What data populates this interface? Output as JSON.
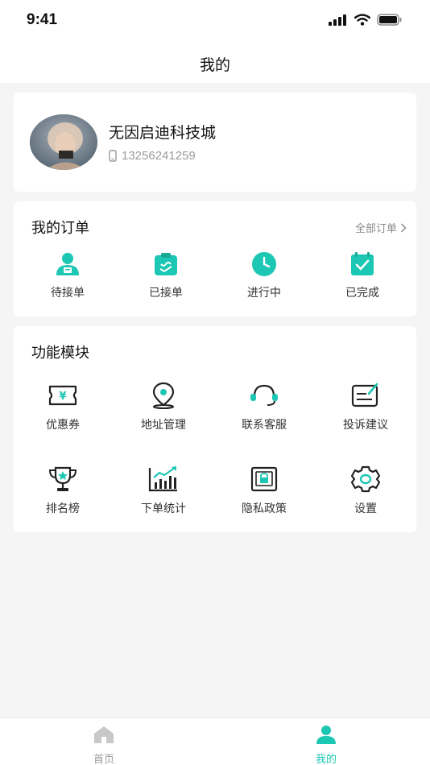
{
  "status_bar": {
    "time": "9:41"
  },
  "header": {
    "title": "我的"
  },
  "profile": {
    "name": "无因启迪科技城",
    "phone": "13256241259"
  },
  "orders": {
    "title": "我的订单",
    "all_label": "全部订单",
    "items": [
      {
        "label": "待接单",
        "icon": "pending-order-icon"
      },
      {
        "label": "已接单",
        "icon": "accepted-order-icon"
      },
      {
        "label": "进行中",
        "icon": "clock-icon"
      },
      {
        "label": "已完成",
        "icon": "completed-check-icon"
      }
    ]
  },
  "modules": {
    "title": "功能模块",
    "items": [
      {
        "label": "优惠券",
        "icon": "coupon-icon"
      },
      {
        "label": "地址管理",
        "icon": "location-pin-icon"
      },
      {
        "label": "联系客服",
        "icon": "headset-icon"
      },
      {
        "label": "投诉建议",
        "icon": "feedback-icon"
      },
      {
        "label": "排名榜",
        "icon": "trophy-icon"
      },
      {
        "label": "下单统计",
        "icon": "chart-icon"
      },
      {
        "label": "隐私政策",
        "icon": "lock-icon"
      },
      {
        "label": "设置",
        "icon": "gear-icon"
      }
    ]
  },
  "tab_bar": {
    "items": [
      {
        "label": "首页",
        "icon": "home-icon",
        "active": false
      },
      {
        "label": "我的",
        "icon": "profile-icon",
        "active": true
      }
    ]
  },
  "colors": {
    "accent": "#1cc7b3",
    "icon_dark": "#222222",
    "inactive": "#9b9b9b"
  }
}
